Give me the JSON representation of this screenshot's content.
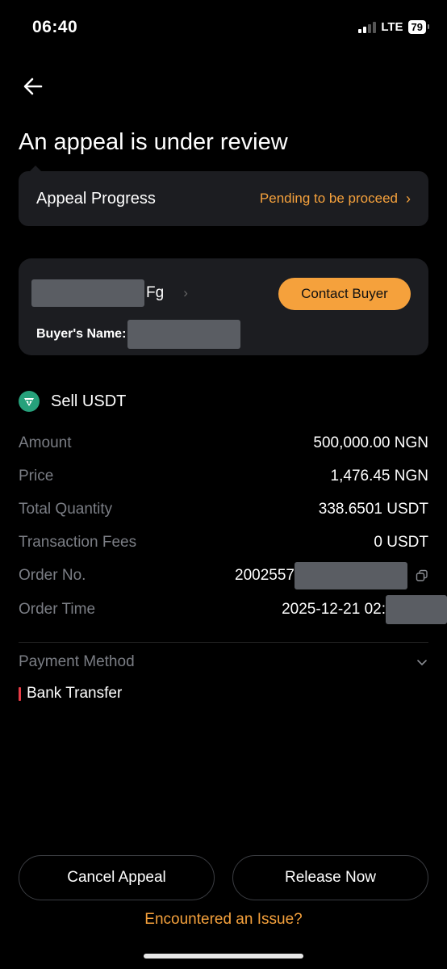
{
  "status_bar": {
    "time": "06:40",
    "network": "LTE",
    "battery": "79"
  },
  "header": {
    "title": "An appeal is under review"
  },
  "appeal": {
    "label": "Appeal Progress",
    "status": "Pending to be proceed",
    "accent": "#f5a13c"
  },
  "buyer": {
    "nickname_suffix": "Fg",
    "contact_label": "Contact Buyer",
    "name_label": "Buyer's Name:"
  },
  "order": {
    "side_label": "Sell USDT",
    "icon": "tether-icon",
    "rows": [
      {
        "label": "Amount",
        "value": "500,000.00 NGN"
      },
      {
        "label": "Price",
        "value": "1,476.45 NGN"
      },
      {
        "label": "Total Quantity",
        "value": "338.6501 USDT"
      },
      {
        "label": "Transaction Fees",
        "value": "0 USDT"
      },
      {
        "label": "Order No.",
        "value": "2002557"
      },
      {
        "label": "Order Time",
        "value": "2025-12-21 02:"
      }
    ]
  },
  "payment": {
    "label": "Payment Method",
    "method": "Bank Transfer",
    "marker_color": "#e63b45"
  },
  "actions": {
    "cancel_label": "Cancel Appeal",
    "release_label": "Release Now",
    "issue_label": "Encountered an Issue?"
  }
}
